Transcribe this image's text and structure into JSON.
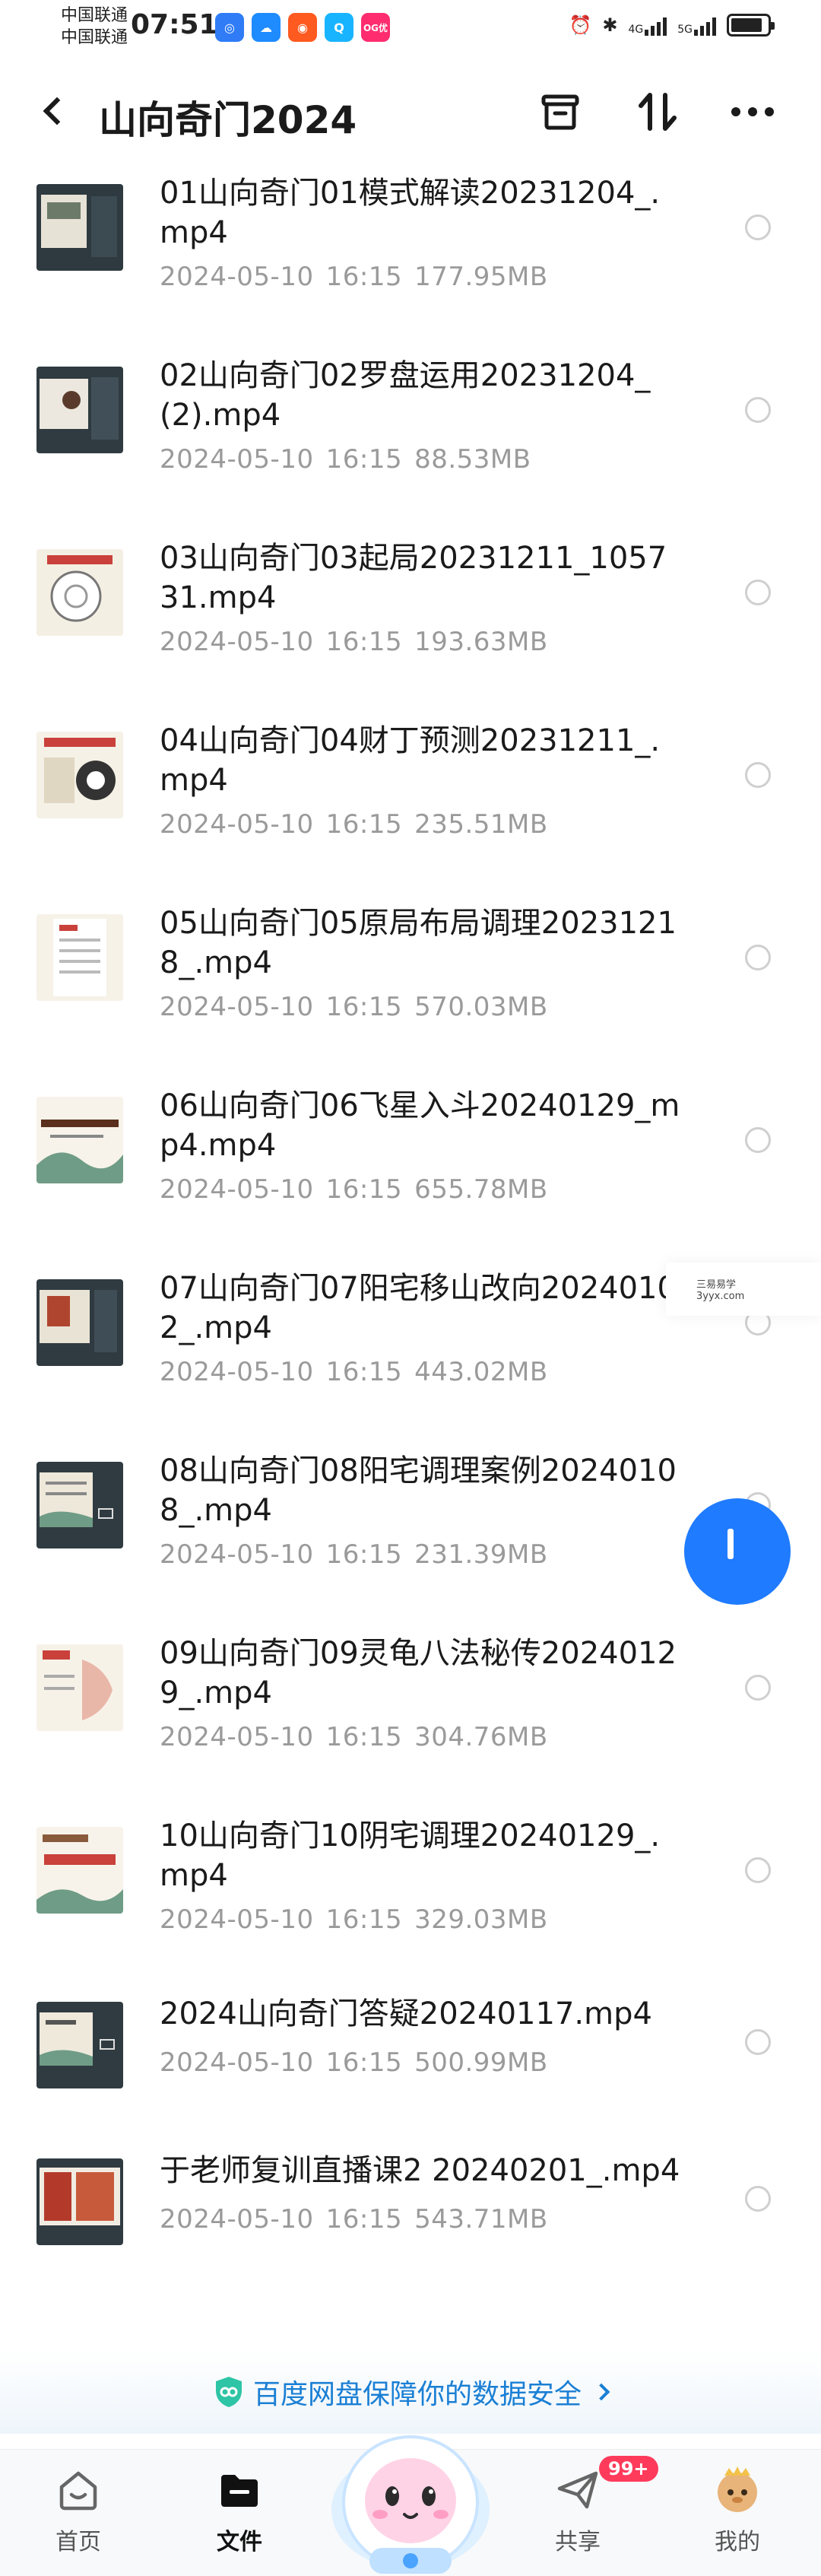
{
  "statusbar": {
    "carrier1": "中国联通",
    "carrier2": "中国联通",
    "time": "07:51",
    "app_badge": "OG优",
    "network1": "4G",
    "network2": "5G"
  },
  "header": {
    "title": "山向奇门2024"
  },
  "files": [
    {
      "name": "01山向奇门01模式解读20231204_.mp4",
      "date": "2024-05-10",
      "time": "16:15",
      "size": "177.95MB"
    },
    {
      "name": "02山向奇门02罗盘运用20231204_(2).mp4",
      "date": "2024-05-10",
      "time": "16:15",
      "size": "88.53MB"
    },
    {
      "name": "03山向奇门03起局20231211_105731.mp4",
      "date": "2024-05-10",
      "time": "16:15",
      "size": "193.63MB"
    },
    {
      "name": "04山向奇门04财丁预测20231211_.mp4",
      "date": "2024-05-10",
      "time": "16:15",
      "size": "235.51MB"
    },
    {
      "name": "05山向奇门05原局布局调理20231218_.mp4",
      "date": "2024-05-10",
      "time": "16:15",
      "size": "570.03MB"
    },
    {
      "name": "06山向奇门06飞星入斗20240129_mp4.mp4",
      "date": "2024-05-10",
      "time": "16:15",
      "size": "655.78MB"
    },
    {
      "name": "07山向奇门07阳宅移山改向20240102_.mp4",
      "date": "2024-05-10",
      "time": "16:15",
      "size": "443.02MB"
    },
    {
      "name": "08山向奇门08阳宅调理案例20240108_.mp4",
      "date": "2024-05-10",
      "time": "16:15",
      "size": "231.39MB"
    },
    {
      "name": "09山向奇门09灵龟八法秘传20240129_.mp4",
      "date": "2024-05-10",
      "time": "16:15",
      "size": "304.76MB"
    },
    {
      "name": "10山向奇门10阴宅调理20240129_.mp4",
      "date": "2024-05-10",
      "time": "16:15",
      "size": "329.03MB"
    },
    {
      "name": "2024山向奇门答疑20240117.mp4",
      "date": "2024-05-10",
      "time": "16:15",
      "size": "500.99MB"
    },
    {
      "name": "于老师复训直播课2 20240201_.mp4",
      "date": "2024-05-10",
      "time": "16:15",
      "size": "543.71MB"
    }
  ],
  "watermark": {
    "line1": "三易易学",
    "line2": "3yyx.com"
  },
  "security_banner": {
    "text": "百度网盘保障你的数据安全"
  },
  "nav": {
    "home": "首页",
    "files": "文件",
    "share": "共享",
    "share_badge": "99+",
    "mine": "我的"
  },
  "colors": {
    "accent": "#1f7bff",
    "security_text": "#1a7fd4",
    "meta_text": "#9a9a9a",
    "badge": "#ff3b5c"
  }
}
